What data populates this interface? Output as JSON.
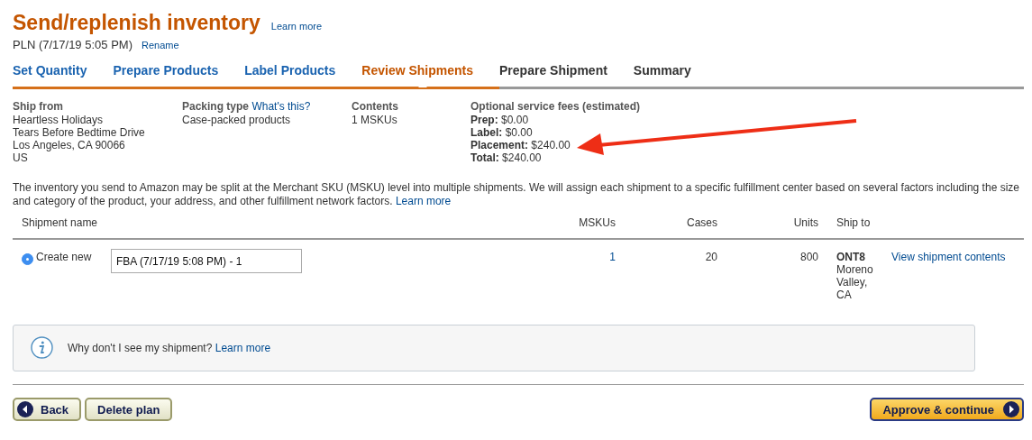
{
  "header": {
    "title": "Send/replenish inventory",
    "help_link": "Learn more",
    "plan_name": "PLN (7/17/19 5:05 PM)",
    "rename_link": "Rename"
  },
  "steps": [
    {
      "label": "Set Quantity",
      "completed": true,
      "selected": false
    },
    {
      "label": "Prepare Products",
      "completed": true,
      "selected": false
    },
    {
      "label": "Label Products",
      "completed": true,
      "selected": false
    },
    {
      "label": "Review Shipments",
      "completed": false,
      "selected": true
    },
    {
      "label": "Prepare Shipment",
      "completed": false,
      "selected": false
    },
    {
      "label": "Summary",
      "completed": false,
      "selected": false
    }
  ],
  "summary": {
    "ship_from": {
      "heading": "Ship from",
      "lines": [
        "Heartless Holidays",
        "Tears Before Bedtime Drive",
        "Los Angeles, CA 90066",
        "US"
      ]
    },
    "packing_type": {
      "heading": "Packing type",
      "help_link": "What's this?",
      "value": "Case-packed products"
    },
    "contents": {
      "heading": "Contents",
      "value": "1 MSKUs"
    },
    "fees": {
      "heading": "Optional service fees (estimated)",
      "lines": [
        {
          "label": "Prep:",
          "value": "$0.00"
        },
        {
          "label": "Label:",
          "value": "$0.00"
        },
        {
          "label": "Placement:",
          "value": "$240.00"
        },
        {
          "label": "Total:",
          "value": "$240.00"
        }
      ]
    }
  },
  "notice": {
    "text": "The inventory you send to Amazon may be split at the Merchant SKU (MSKU) level into multiple shipments. We will assign each shipment to a specific fulfillment center based on several factors including the size and category of the product, your address, and other fulfillment network factors.",
    "link": "Learn more"
  },
  "table": {
    "columns": [
      "Shipment name",
      "MSKUs",
      "Cases",
      "Units",
      "Ship to"
    ],
    "rows": [
      {
        "option": "Create new",
        "selected": true,
        "name_value": "FBA (7/17/19 5:08 PM) - 1",
        "mskus": "1",
        "cases": "20",
        "units": "800",
        "ship_to_code": "ONT8",
        "ship_to_city": "Moreno Valley, CA",
        "action_link": "View shipment contents"
      }
    ]
  },
  "info_box": {
    "text": "Why don't I see my shipment?",
    "link": "Learn more"
  },
  "buttons": [
    {
      "label": "Back",
      "kind": "back"
    },
    {
      "label": "Delete plan",
      "kind": "plain"
    },
    {
      "label": "Approve & continue",
      "kind": "primary"
    }
  ]
}
